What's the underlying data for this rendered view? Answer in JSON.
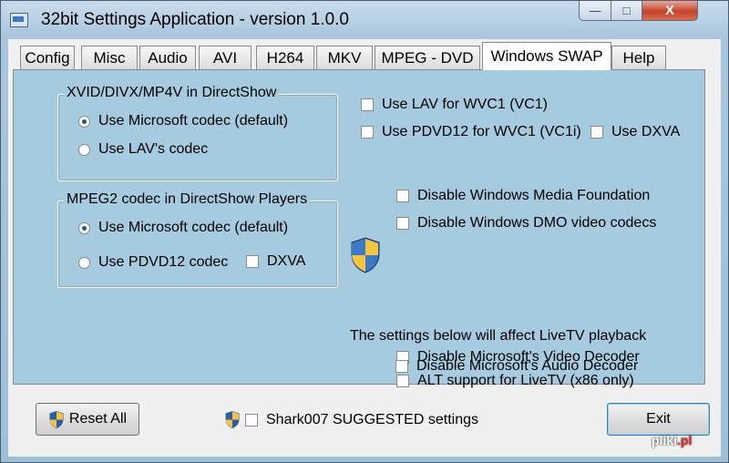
{
  "window": {
    "title": "32bit Settings Application - version 1.0.0"
  },
  "title_controls": {
    "minimize": "—",
    "maximize": "□",
    "close": "X"
  },
  "tabs": [
    {
      "label": "Config"
    },
    {
      "label": "Misc"
    },
    {
      "label": "Audio"
    },
    {
      "label": "AVI"
    },
    {
      "label": "H264"
    },
    {
      "label": "MKV"
    },
    {
      "label": "MPEG - DVD"
    },
    {
      "label": "Windows SWAP",
      "active": true
    },
    {
      "label": "Help"
    }
  ],
  "group_xvid": {
    "label": "XVID/DIVX/MP4V in DirectShow",
    "options": [
      {
        "label": "Use Microsoft codec (default)",
        "selected": true
      },
      {
        "label": "Use LAV's codec",
        "selected": false
      }
    ]
  },
  "group_mpeg2": {
    "label": "MPEG2 codec in DirectShow Players",
    "options": [
      {
        "label": "Use Microsoft codec (default)",
        "selected": true
      },
      {
        "label": "Use PDVD12 codec",
        "selected": false
      }
    ],
    "dxva": {
      "label": "DXVA",
      "checked": false
    }
  },
  "right_checks": {
    "lav_wvc1": {
      "label": "Use LAV for WVC1 (VC1)",
      "checked": false
    },
    "pdvd_wvc1": {
      "label": "Use PDVD12 for WVC1 (VC1i)",
      "checked": false
    },
    "use_dxva": {
      "label": "Use DXVA",
      "checked": false
    },
    "disable_wmf": {
      "label": "Disable Windows Media Foundation",
      "checked": false
    },
    "disable_dmo": {
      "label": "Disable Windows DMO video codecs",
      "checked": false
    }
  },
  "livetv": {
    "heading": "The settings below will affect LiveTV playback",
    "video_decoder": {
      "label": "Disable Microsoft's Video Decoder",
      "checked": false
    },
    "alt_support": {
      "label": "ALT support for LiveTV (x86 only)",
      "checked": false
    },
    "audio_decoder": {
      "label": "Disable Microsoft's Audio Decoder",
      "checked": false
    }
  },
  "footer": {
    "reset_label": "Reset All",
    "suggested_label": "Shark007 SUGGESTED settings",
    "exit_label": "Exit"
  },
  "watermark": {
    "text": "pliki",
    "suffix": ".pl"
  }
}
